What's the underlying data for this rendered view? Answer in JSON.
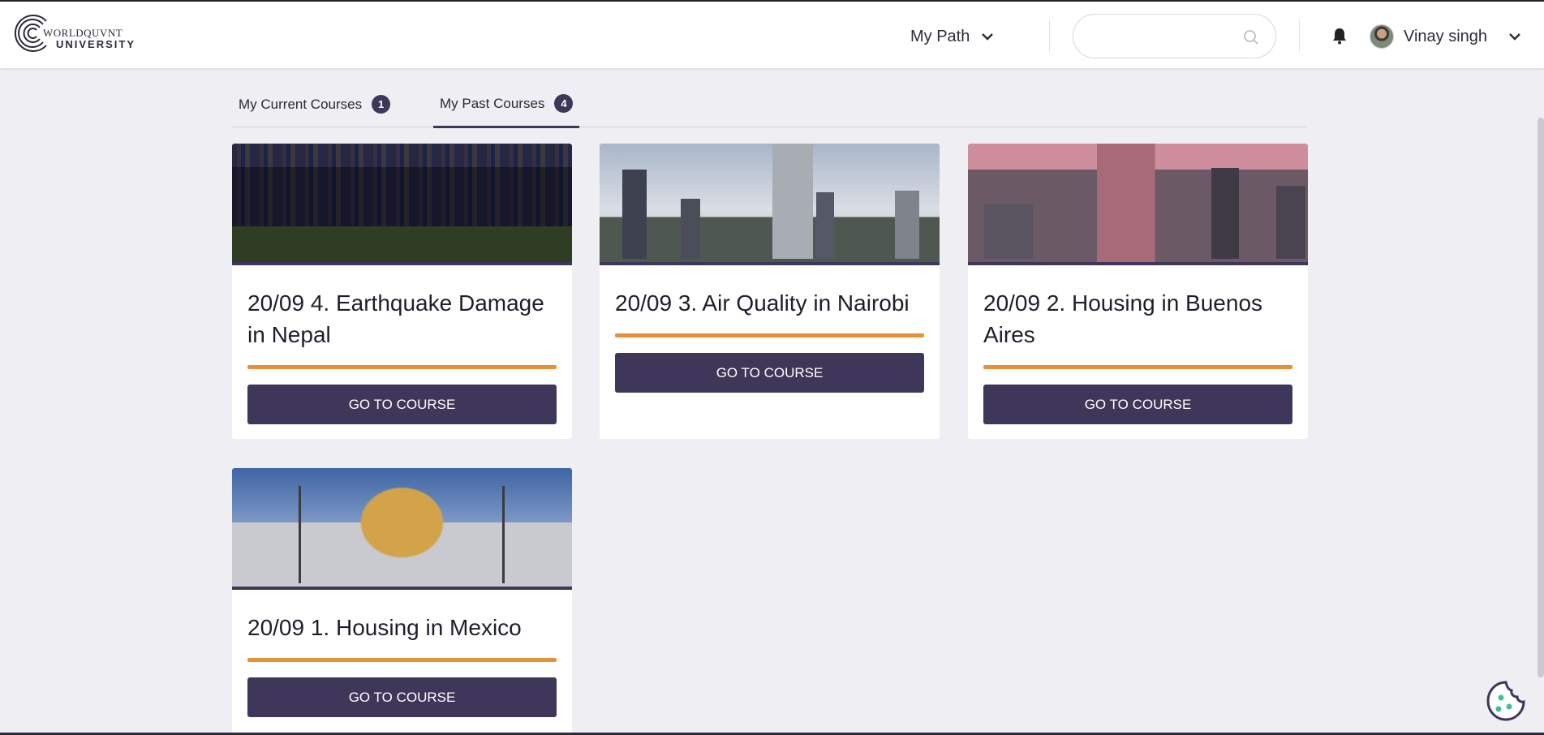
{
  "header": {
    "logo_line1": "WORLDQUVNT",
    "logo_line2": "UNIVERSITY",
    "nav_label": "My Path",
    "search_placeholder": "",
    "user_name": "Vinay singh"
  },
  "tabs": [
    {
      "label": "My Current Courses",
      "count": "1",
      "active": false
    },
    {
      "label": "My Past Courses",
      "count": "4",
      "active": true
    }
  ],
  "courses": [
    {
      "title": "20/09 4. Earthquake Damage in Nepal",
      "button": "GO TO COURSE",
      "image": "nepal-hillside-houses"
    },
    {
      "title": "20/09 3. Air Quality in Nairobi",
      "button": "GO TO COURSE",
      "image": "nairobi-skyline"
    },
    {
      "title": "20/09 2. Housing in Buenos Aires",
      "button": "GO TO COURSE",
      "image": "buenos-aires-waterfront"
    },
    {
      "title": "20/09 1. Housing in Mexico",
      "button": "GO TO COURSE",
      "image": "mexico-palace-dome"
    }
  ],
  "colors": {
    "brand": "#3f3759",
    "accent": "#e69138",
    "background": "#efeef3"
  }
}
